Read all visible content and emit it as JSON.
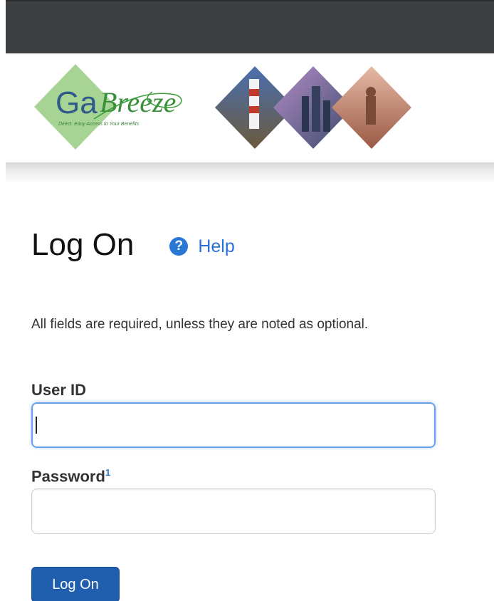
{
  "header": {
    "logo_text_ga": "Ga",
    "logo_text_breeze": "Breeze",
    "logo_tagline": "Direct. Easy Access to Your Benefits"
  },
  "main": {
    "title": "Log On",
    "help_label": "Help",
    "help_icon_glyph": "?",
    "instructions": "All fields are required, unless they are noted as optional."
  },
  "form": {
    "user_id_label": "User ID",
    "user_id_value": "",
    "password_label": "Password",
    "password_footnote": "1",
    "password_value": "",
    "submit_label": "Log On"
  },
  "colors": {
    "topbar": "#3d4042",
    "link": "#2a6fd6",
    "button": "#1f5fae",
    "logo_green": "#9fd08a"
  }
}
